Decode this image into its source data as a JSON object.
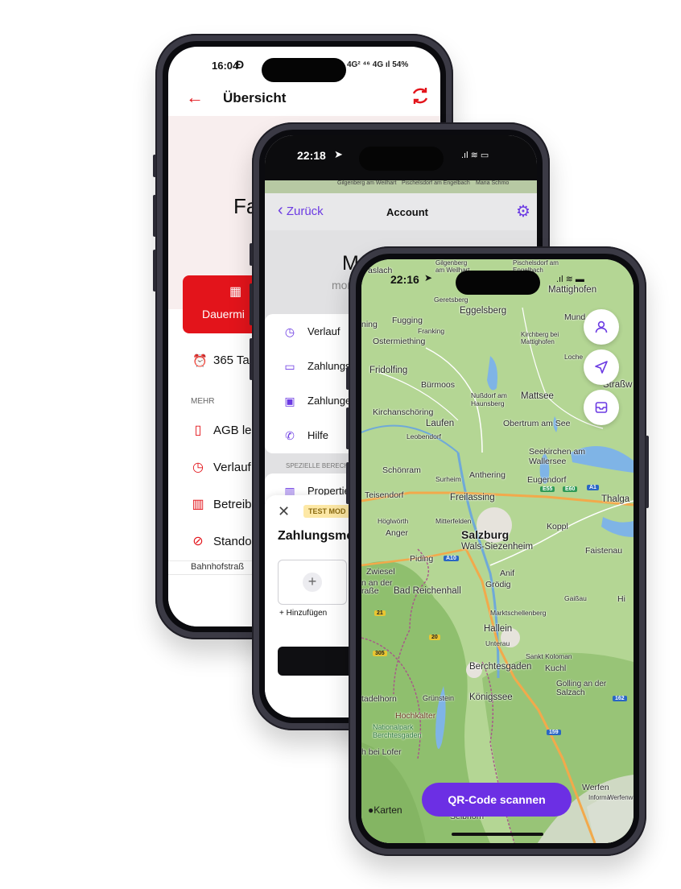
{
  "phone1": {
    "status": {
      "time": "16:04",
      "right": "4G² ⁴⁶ 4G ıl 54%"
    },
    "header": {
      "title": "Übersicht"
    },
    "hero_text": "Fa",
    "plan_button": "Dauermi",
    "duration_text": "365 Ta",
    "section_more": "MEHR",
    "menu": [
      "AGB les",
      "Verlauf",
      "Betreib",
      "Stando"
    ],
    "address": "Bahnhofstraß"
  },
  "phone2": {
    "status": {
      "time": "22:18"
    },
    "nav": {
      "back": "Zurück",
      "title": "Account"
    },
    "user_name": "Moritz Wei",
    "user_sub": "moritz",
    "rows": [
      "Verlauf",
      "Zahlungsm",
      "Zahlungen",
      "Hilfe"
    ],
    "section_special": "SPEZIELLE BERECH",
    "properties": "Properties",
    "sheet": {
      "badge": "TEST MOD",
      "title": "Zahlungsme",
      "add_label": "+ Hinzufügen"
    },
    "map_labels": [
      "Gilgenberg am Weilhart",
      "Pischelsdorf am Engelbach",
      "Maria Schmo"
    ]
  },
  "phone3": {
    "status": {
      "time": "22:16"
    },
    "map_brand": "Karten",
    "qr_button": "QR-Code scannen",
    "places": {
      "top1": "aslach",
      "top2": "Gilgenberg am Weilhart",
      "top3": "Pischelsdorf am Engelbach",
      "mattighofen": "Mattighofen",
      "geretsberg": "Geretsberg",
      "eggelsberg": "Eggelsberg",
      "mund": "Mund",
      "ning": "ning",
      "fugging": "Fugging",
      "franking": "Franking",
      "ostermiething": "Ostermiething",
      "kirchberg": "Kirchberg bei Mattighofen",
      "loche": "Loche",
      "fridolfing": "Fridolfing",
      "buermoos": "Bürmoos",
      "strasswalchen": "Straßw",
      "nussdorf": "Nußdorf am Haunsberg",
      "mattsee": "Mattsee",
      "kirchanschoering": "Kirchanschöring",
      "laufen": "Laufen",
      "obertrum": "Obertrum am See",
      "leobendorf": "Leobendorf",
      "seekirchen": "Seekirchen am Wallersee",
      "schoenram": "Schönram",
      "anthering": "Anthering",
      "surheim": "Surheim",
      "eugendorf": "Eugendorf",
      "teisendorf": "Teisendorf",
      "freilassing": "Freilassing",
      "thalgau": "Thalga",
      "hoeglwoerth": "Höglwörth",
      "mitterfelden": "Mitterfelden",
      "koppl": "Koppl",
      "anger": "Anger",
      "salzburg": "Salzburg",
      "wals": "Wals-Siezenheim",
      "piding": "Piding",
      "faistenau": "Faistenau",
      "ziesel": "Zwiesel",
      "anif": "Anif",
      "nander": "n an der",
      "grodig": "Grödig",
      "strasse": "raße",
      "reichenhall": "Bad Reichenhall",
      "gaissau": "Gaißau",
      "hin": "Hi",
      "marktschellenberg": "Marktschellenberg",
      "hallein": "Hallein",
      "unterau": "Unterau",
      "koloman": "Sankt Koloman",
      "kuchl": "Kuchl",
      "berchtesgaden": "Berchtesgaden",
      "golling": "Golling an der Salzach",
      "tadelhorn": "tadelhorn",
      "gruenstein": "Grünstein",
      "koenigssee": "Königssee",
      "hochkalter": "Hochkalter",
      "nationalpark": "Nationalpark Berchtesgaden",
      "beilofer": "h bei Lofer",
      "werfen": "Werfen",
      "information": "Informa",
      "werfenweng": "Werfenw",
      "selbhorn": "Selbhorn"
    },
    "roads": [
      "A1",
      "E55",
      "E60",
      "A10",
      "21",
      "20",
      "305",
      "159",
      "162"
    ]
  }
}
